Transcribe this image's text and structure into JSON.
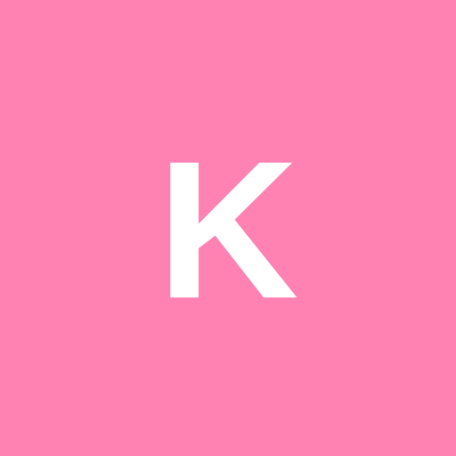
{
  "avatar": {
    "letter": "K",
    "background_color": "#FF82B2",
    "text_color": "#FFFFFF"
  }
}
